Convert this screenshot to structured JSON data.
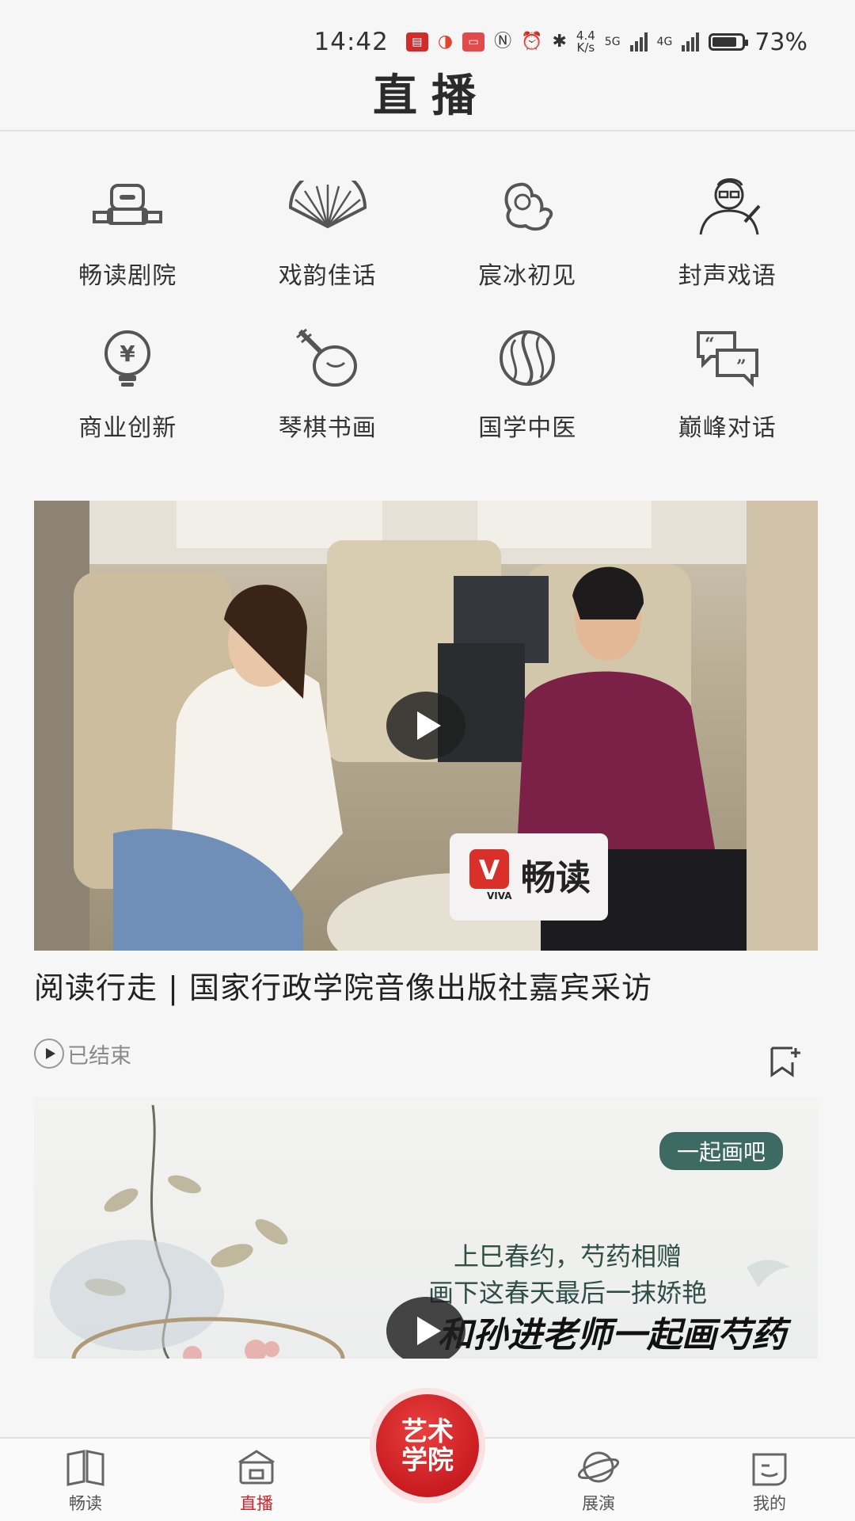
{
  "status_bar": {
    "time": "14:42",
    "net_speed": "4.4\nK/s",
    "net_speed_top": "4.4",
    "net_speed_unit": "K/s",
    "signal1": "5G",
    "signal2": "4G",
    "battery": "73%",
    "battery_level": 0.73
  },
  "header": {
    "title": "直播"
  },
  "categories": [
    {
      "label": "畅读剧院",
      "icon": "theater-seat-icon"
    },
    {
      "label": "戏韵佳话",
      "icon": "fan-icon"
    },
    {
      "label": "宸冰初见",
      "icon": "woman-portrait-icon"
    },
    {
      "label": "封声戏语",
      "icon": "man-portrait-icon"
    },
    {
      "label": "商业创新",
      "icon": "yen-bulb-icon"
    },
    {
      "label": "琴棋书画",
      "icon": "pipa-instrument-icon"
    },
    {
      "label": "国学中医",
      "icon": "yin-yang-icon"
    },
    {
      "label": "巅峰对话",
      "icon": "dialogue-bubbles-icon"
    }
  ],
  "cards": [
    {
      "title": "阅读行走 | 国家行政学院音像出版社嘉宾采访",
      "status": "已结束",
      "logo_text": "畅读",
      "logo_sub": "VIVA"
    },
    {
      "tag": "一起画吧",
      "poem_line1": "上巳春约，芍药相赠",
      "poem_line2": "画下这春天最后一抹娇艳",
      "calligraphy": "和孙进老师一起画芍药"
    }
  ],
  "tabbar": {
    "tabs": [
      {
        "label": "畅读",
        "icon": "book-icon"
      },
      {
        "label": "直播",
        "icon": "house-tv-icon"
      },
      {
        "label": "展演",
        "icon": "planet-icon"
      },
      {
        "label": "我的",
        "icon": "face-icon"
      }
    ],
    "center": "艺术学院",
    "active_color": "#d0242a"
  }
}
